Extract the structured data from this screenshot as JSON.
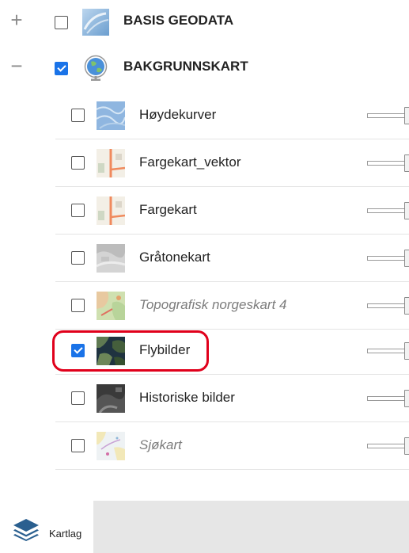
{
  "groups": [
    {
      "expander": "+",
      "label": "BASIS GEODATA",
      "checked": false,
      "icon": "basis-geodata-thumb"
    },
    {
      "expander": "−",
      "label": "BAKGRUNNSKART",
      "checked": true,
      "icon": "globe-icon"
    }
  ],
  "layers": [
    {
      "label": "Høydekurver",
      "checked": false,
      "disabled": false,
      "icon": "hoydekurver-thumb"
    },
    {
      "label": "Fargekart_vektor",
      "checked": false,
      "disabled": false,
      "icon": "fargekart-vektor-thumb"
    },
    {
      "label": "Fargekart",
      "checked": false,
      "disabled": false,
      "icon": "fargekart-thumb"
    },
    {
      "label": "Gråtonekart",
      "checked": false,
      "disabled": false,
      "icon": "gratonekart-thumb"
    },
    {
      "label": "Topografisk norgeskart 4",
      "checked": false,
      "disabled": true,
      "icon": "topografisk-thumb"
    },
    {
      "label": "Flybilder",
      "checked": true,
      "disabled": false,
      "icon": "flybilder-thumb"
    },
    {
      "label": "Historiske bilder",
      "checked": false,
      "disabled": false,
      "icon": "historiske-bilder-thumb"
    },
    {
      "label": "Sjøkart",
      "checked": false,
      "disabled": true,
      "icon": "sjokart-thumb"
    }
  ],
  "bottom_bar": {
    "kartlag_label": "Kartlag",
    "icon": "layers-icon"
  },
  "colors": {
    "accent": "#1a73e8",
    "highlight": "#e0001b",
    "bottom_bar": "#e6e6e6"
  }
}
